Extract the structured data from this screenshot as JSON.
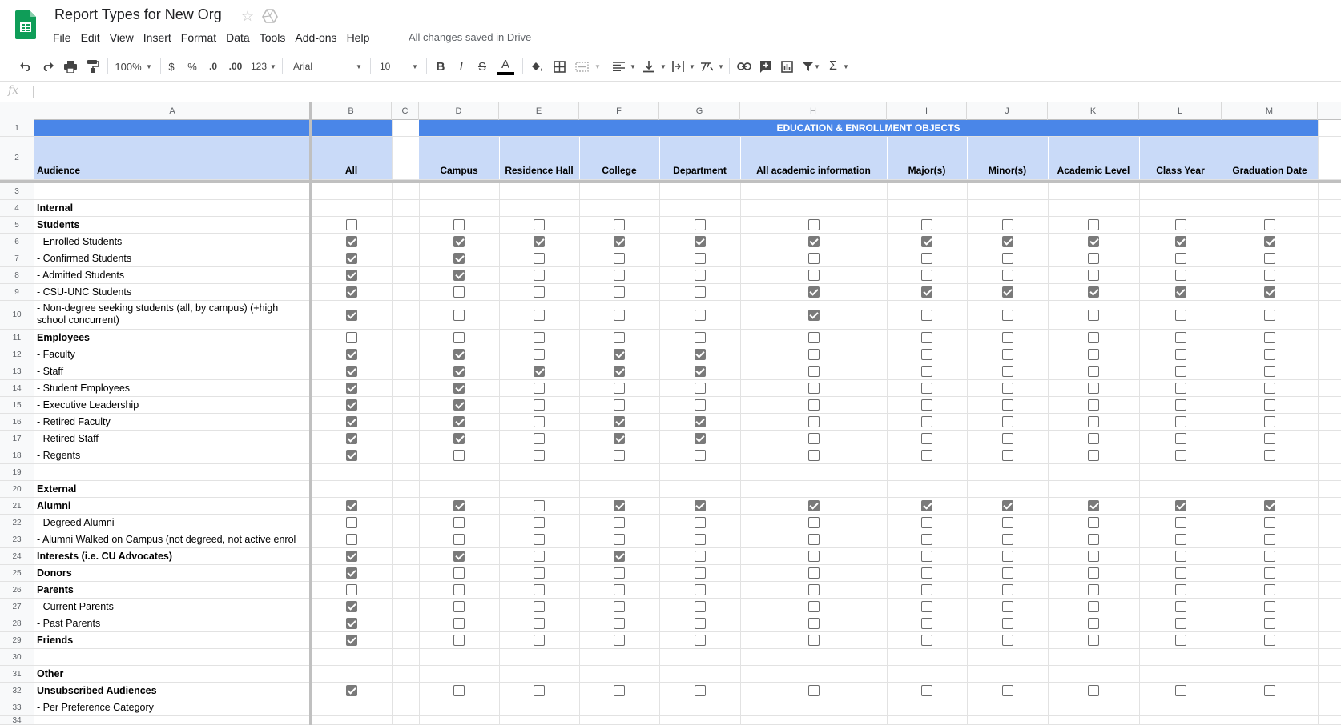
{
  "app": {
    "title": "Report Types for New Org",
    "save_status": "All changes saved in Drive",
    "menu": [
      "File",
      "Edit",
      "View",
      "Insert",
      "Format",
      "Data",
      "Tools",
      "Add-ons",
      "Help"
    ]
  },
  "toolbar": {
    "zoom": "100%",
    "currency": "$",
    "percent": "%",
    "decrease_decimal": ".0",
    "increase_decimal": ".00",
    "more_formats": "123",
    "font": "Arial",
    "font_size": "10",
    "bold": "B",
    "italic": "I",
    "strikethrough": "S",
    "text_color": "A",
    "sum": "Σ"
  },
  "formula_bar": {
    "fx_label": "fx",
    "value": ""
  },
  "grid": {
    "column_letters": [
      "A",
      "B",
      "C",
      "D",
      "E",
      "F",
      "G",
      "H",
      "I",
      "J",
      "K",
      "L",
      "M"
    ],
    "band_title": "EDUCATION & ENROLLMENT OBJECTS",
    "audience_header": "Audience",
    "column_labels": [
      "All",
      "",
      "Campus",
      "Residence Hall",
      "College",
      "Department",
      "All academic information",
      "Major(s)",
      "Minor(s)",
      "Academic Level",
      "Class Year",
      "Graduation Date"
    ],
    "rows": [
      {
        "n": "3",
        "label": "",
        "bold": false,
        "checks": null
      },
      {
        "n": "4",
        "label": "Internal",
        "bold": true,
        "checks": null
      },
      {
        "n": "5",
        "label": "Students",
        "bold": true,
        "checks": [
          0,
          0,
          0,
          0,
          0,
          0,
          0,
          0,
          0,
          0,
          0
        ]
      },
      {
        "n": "6",
        "label": " - Enrolled Students",
        "bold": false,
        "checks": [
          1,
          1,
          1,
          1,
          1,
          1,
          1,
          1,
          1,
          1,
          1
        ]
      },
      {
        "n": "7",
        "label": " - Confirmed Students",
        "bold": false,
        "checks": [
          1,
          1,
          0,
          0,
          0,
          0,
          0,
          0,
          0,
          0,
          0
        ]
      },
      {
        "n": "8",
        "label": " - Admitted Students",
        "bold": false,
        "checks": [
          1,
          1,
          0,
          0,
          0,
          0,
          0,
          0,
          0,
          0,
          0
        ]
      },
      {
        "n": "9",
        "label": " - CSU-UNC Students",
        "bold": false,
        "checks": [
          1,
          0,
          0,
          0,
          0,
          1,
          1,
          1,
          1,
          1,
          1
        ]
      },
      {
        "n": "10",
        "label": " - Non-degree seeking students (all, by campus) (+high school concurrent)",
        "bold": false,
        "checks": [
          1,
          0,
          0,
          0,
          0,
          1,
          0,
          0,
          0,
          0,
          0
        ],
        "tall": true
      },
      {
        "n": "11",
        "label": "Employees",
        "bold": true,
        "checks": [
          0,
          0,
          0,
          0,
          0,
          0,
          0,
          0,
          0,
          0,
          0
        ]
      },
      {
        "n": "12",
        "label": " - Faculty",
        "bold": false,
        "checks": [
          1,
          1,
          0,
          1,
          1,
          0,
          0,
          0,
          0,
          0,
          0
        ]
      },
      {
        "n": "13",
        "label": " - Staff",
        "bold": false,
        "checks": [
          1,
          1,
          1,
          1,
          1,
          0,
          0,
          0,
          0,
          0,
          0
        ]
      },
      {
        "n": "14",
        "label": " - Student Employees",
        "bold": false,
        "checks": [
          1,
          1,
          0,
          0,
          0,
          0,
          0,
          0,
          0,
          0,
          0
        ]
      },
      {
        "n": "15",
        "label": " - Executive Leadership",
        "bold": false,
        "checks": [
          1,
          1,
          0,
          0,
          0,
          0,
          0,
          0,
          0,
          0,
          0
        ]
      },
      {
        "n": "16",
        "label": " - Retired Faculty",
        "bold": false,
        "checks": [
          1,
          1,
          0,
          1,
          1,
          0,
          0,
          0,
          0,
          0,
          0
        ]
      },
      {
        "n": "17",
        "label": " - Retired Staff",
        "bold": false,
        "checks": [
          1,
          1,
          0,
          1,
          1,
          0,
          0,
          0,
          0,
          0,
          0
        ]
      },
      {
        "n": "18",
        "label": " - Regents",
        "bold": false,
        "checks": [
          1,
          0,
          0,
          0,
          0,
          0,
          0,
          0,
          0,
          0,
          0
        ]
      },
      {
        "n": "19",
        "label": "",
        "bold": false,
        "checks": null
      },
      {
        "n": "20",
        "label": "External",
        "bold": true,
        "checks": null
      },
      {
        "n": "21",
        "label": "Alumni",
        "bold": true,
        "checks": [
          1,
          1,
          0,
          1,
          1,
          1,
          1,
          1,
          1,
          1,
          1
        ]
      },
      {
        "n": "22",
        "label": " - Degreed Alumni",
        "bold": false,
        "checks": [
          0,
          0,
          0,
          0,
          0,
          0,
          0,
          0,
          0,
          0,
          0
        ]
      },
      {
        "n": "23",
        "label": " - Alumni Walked on Campus (not degreed, not active enrol",
        "bold": false,
        "checks": [
          0,
          0,
          0,
          0,
          0,
          0,
          0,
          0,
          0,
          0,
          0
        ]
      },
      {
        "n": "24",
        "label": "Interests (i.e. CU Advocates)",
        "bold": true,
        "checks": [
          1,
          1,
          0,
          1,
          0,
          0,
          0,
          0,
          0,
          0,
          0
        ]
      },
      {
        "n": "25",
        "label": "Donors",
        "bold": true,
        "checks": [
          1,
          0,
          0,
          0,
          0,
          0,
          0,
          0,
          0,
          0,
          0
        ]
      },
      {
        "n": "26",
        "label": "Parents",
        "bold": true,
        "checks": [
          0,
          0,
          0,
          0,
          0,
          0,
          0,
          0,
          0,
          0,
          0
        ]
      },
      {
        "n": "27",
        "label": " - Current Parents",
        "bold": false,
        "checks": [
          1,
          0,
          0,
          0,
          0,
          0,
          0,
          0,
          0,
          0,
          0
        ]
      },
      {
        "n": "28",
        "label": " - Past Parents",
        "bold": false,
        "checks": [
          1,
          0,
          0,
          0,
          0,
          0,
          0,
          0,
          0,
          0,
          0
        ]
      },
      {
        "n": "29",
        "label": "Friends",
        "bold": true,
        "checks": [
          1,
          0,
          0,
          0,
          0,
          0,
          0,
          0,
          0,
          0,
          0
        ]
      },
      {
        "n": "30",
        "label": "",
        "bold": false,
        "checks": null
      },
      {
        "n": "31",
        "label": "Other",
        "bold": true,
        "checks": null
      },
      {
        "n": "32",
        "label": "Unsubscribed Audiences",
        "bold": true,
        "checks": [
          1,
          0,
          0,
          0,
          0,
          0,
          0,
          0,
          0,
          0,
          0
        ]
      },
      {
        "n": "33",
        "label": " - Per Preference Category",
        "bold": false,
        "checks": null
      }
    ]
  }
}
